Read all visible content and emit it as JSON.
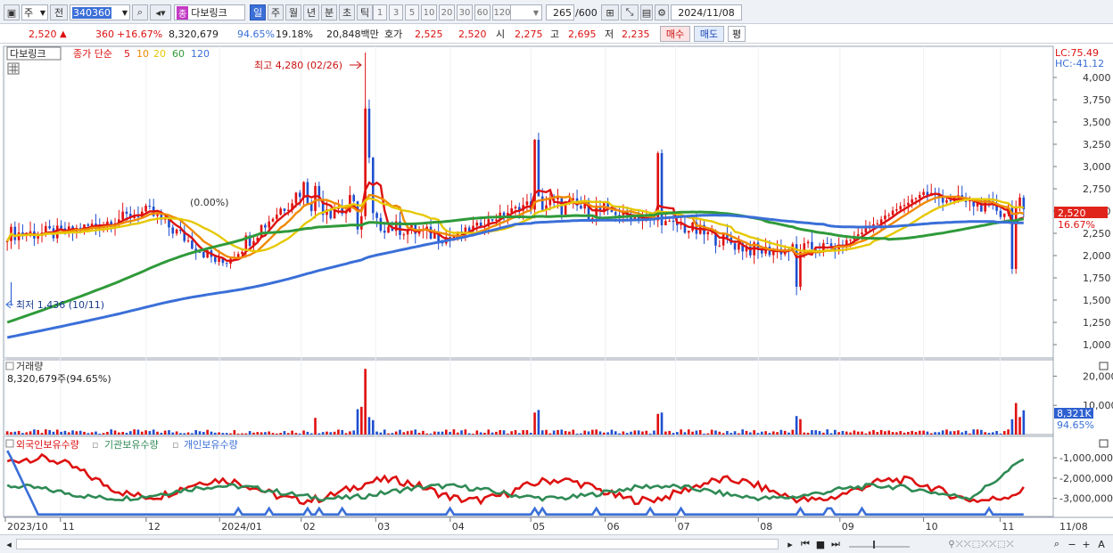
{
  "toolbar": {
    "period_type": "주",
    "period_prev": "전",
    "code": "340360",
    "stock_name": "다보링크",
    "stock_badge": "종",
    "intervals": [
      "일",
      "주",
      "월",
      "년",
      "분",
      "초",
      "틱"
    ],
    "active_interval": "일",
    "minutes": [
      "1",
      "3",
      "5",
      "10",
      "20",
      "30",
      "60",
      "120"
    ],
    "count": "265",
    "count_max": "/600",
    "date": "2024/11/08"
  },
  "quote": {
    "price": "2,520",
    "change_arrow": "▲",
    "change": "360",
    "change_pct": "+16.67%",
    "volume": "8,320,679",
    "volume_ratio": "94.65%",
    "turnover": "19.18%",
    "amount": "20,848백만",
    "bid_label": "호가",
    "ask": "2,525",
    "bid": "2,520",
    "open_label": "시",
    "open": "2,275",
    "high_label": "고",
    "high": "2,695",
    "low_label": "저",
    "low": "2,235",
    "buy_label": "매수",
    "sell_label": "매도",
    "avg_label": "평"
  },
  "price_panel": {
    "stock_tag": "다보링크",
    "ma_legend": {
      "label": "종가 단순",
      "periods": [
        {
          "p": "5",
          "color": "#dd1111"
        },
        {
          "p": "10",
          "color": "#f08a00"
        },
        {
          "p": "20",
          "color": "#e6c800"
        },
        {
          "p": "60",
          "color": "#2f9a3a"
        },
        {
          "p": "120",
          "color": "#3a6fd8"
        }
      ]
    },
    "max_label": "최고 4,280 (02/26)",
    "min_label": "최저 1,436 (10/11)",
    "split_label": "(0.00%)",
    "lc_label": "LC:75.49",
    "hc_label": "HC:-41.12",
    "current_price_tag": "2,520",
    "current_pct_tag": "16.67%",
    "y_ticks": [
      "4,000",
      "3,750",
      "3,500",
      "3,250",
      "3,000",
      "2,750",
      "2,500",
      "2,250",
      "2,000",
      "1,750",
      "1,500",
      "1,250",
      "1,000"
    ]
  },
  "volume_panel": {
    "title": "거래량",
    "subtitle": "8,320,679주(94.65%)",
    "y_ticks": [
      "20,000K",
      "10,000K"
    ],
    "current_tag": "8,321K",
    "current_pct": "94.65%"
  },
  "holding_panel": {
    "legend": [
      {
        "label": "외국인보유수량",
        "color": "#dd1111"
      },
      {
        "label": "기관보유수량",
        "color": "#2f8a55"
      },
      {
        "label": "개인보유수량",
        "color": "#3a6fd8"
      }
    ],
    "y_ticks": [
      "-1,000,000",
      "-2,000,000",
      "-3,000,000"
    ]
  },
  "x_axis": {
    "labels": [
      "2023/10",
      "11",
      "12",
      "2024/01",
      "02",
      "03",
      "04",
      "05",
      "06",
      "07",
      "08",
      "09",
      "10",
      "11"
    ],
    "right_label": "11/08"
  },
  "chart_data": {
    "type": "candlestick",
    "y_range": [
      850,
      4350
    ],
    "ohlc_monthly_approx": [
      {
        "x": "2023/10",
        "o": 1500,
        "h": 2400,
        "l": 1436,
        "c": 2250
      },
      {
        "x": "11",
        "o": 2250,
        "h": 2500,
        "l": 1750,
        "c": 2250
      },
      {
        "x": "12",
        "o": 2250,
        "h": 3050,
        "l": 2150,
        "c": 2500
      },
      {
        "x": "2024/01",
        "o": 2500,
        "h": 2600,
        "l": 1500,
        "c": 1900
      },
      {
        "x": "02",
        "o": 1900,
        "h": 4280,
        "l": 1850,
        "c": 2750
      },
      {
        "x": "03",
        "o": 2750,
        "h": 3150,
        "l": 2200,
        "c": 2350
      },
      {
        "x": "04",
        "o": 2350,
        "h": 2500,
        "l": 2050,
        "c": 2200
      },
      {
        "x": "05",
        "o": 2200,
        "h": 3500,
        "l": 2200,
        "c": 2600
      },
      {
        "x": "06",
        "o": 2600,
        "h": 2750,
        "l": 2300,
        "c": 2500
      },
      {
        "x": "07",
        "o": 2500,
        "h": 3250,
        "l": 2250,
        "c": 2350
      },
      {
        "x": "08",
        "o": 2350,
        "h": 2400,
        "l": 1550,
        "c": 2050
      },
      {
        "x": "09",
        "o": 2050,
        "h": 2200,
        "l": 1950,
        "c": 2100
      },
      {
        "x": "10",
        "o": 2100,
        "h": 2900,
        "l": 2100,
        "c": 2700
      },
      {
        "x": "11",
        "o": 2700,
        "h": 3050,
        "l": 1500,
        "c": 2520
      }
    ],
    "current_price": 2520,
    "max": {
      "value": 4280,
      "date": "02/26"
    },
    "min": {
      "value": 1436,
      "date": "10/11"
    }
  },
  "bottom": {
    "icons": [
      "scroll-left-icon",
      "play-icon",
      "rewind-icon",
      "stop-icon",
      "forward-icon",
      "zoom-out-icon",
      "minus-icon",
      "plus-icon",
      "text-tool-icon"
    ]
  }
}
